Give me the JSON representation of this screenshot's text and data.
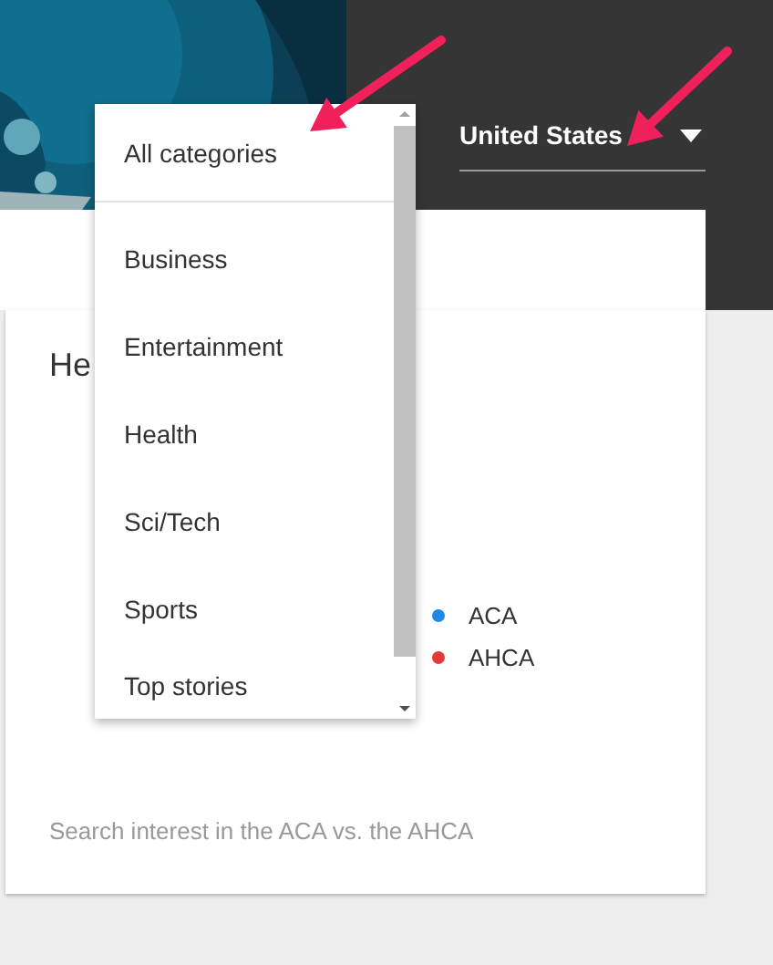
{
  "header": {
    "country_select": {
      "value": "United States"
    }
  },
  "category_menu": {
    "items": [
      {
        "label": "All categories",
        "selected": true
      },
      {
        "label": "Business",
        "selected": false
      },
      {
        "label": "Entertainment",
        "selected": false
      },
      {
        "label": "Health",
        "selected": false
      },
      {
        "label": "Sci/Tech",
        "selected": false
      },
      {
        "label": "Sports",
        "selected": false
      },
      {
        "label": "Top stories",
        "selected": false
      }
    ]
  },
  "card": {
    "title": "He",
    "legend": [
      {
        "label": "ACA",
        "color": "#1e88e5"
      },
      {
        "label": "AHCA",
        "color": "#e53935"
      }
    ],
    "caption": "Search interest in the ACA vs. the AHCA"
  }
}
